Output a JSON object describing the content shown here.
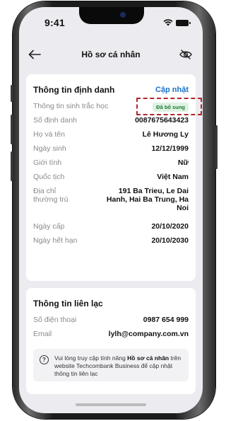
{
  "status_bar": {
    "time": "9:41"
  },
  "header": {
    "title": "Hồ sơ cá nhân"
  },
  "identity": {
    "title": "Thông tin định danh",
    "update_link": "Cập nhật",
    "biometric": {
      "label": "Thông tin sinh trắc học",
      "badge": "Đã bổ sung"
    },
    "rows": [
      {
        "label": "Số định danh",
        "value": "0087675643423"
      },
      {
        "label": "Họ và tên",
        "value": "Lê Hương Ly"
      },
      {
        "label": "Ngày sinh",
        "value": "12/12/1999"
      },
      {
        "label": "Giới tính",
        "value": "Nữ"
      },
      {
        "label": "Quốc tịch",
        "value": "Việt Nam"
      }
    ],
    "address": {
      "label_line1": "Địa chỉ",
      "label_line2": "thường trú",
      "value": "191 Ba Trieu, Le Dai Hanh, Hai Ba Trung, Ha Noi"
    },
    "rows2": [
      {
        "label": "Ngày cấp",
        "value": "20/10/2020"
      },
      {
        "label": "Ngày hết hạn",
        "value": "20/10/2030"
      }
    ]
  },
  "contact": {
    "title": "Thông tin liên lạc",
    "rows": [
      {
        "label": "Số điện thoại",
        "value": "0987 654 999"
      },
      {
        "label": "Email",
        "value": "lylh@company.com.vn"
      }
    ],
    "notice": {
      "icon": "?",
      "part1": "Vui lòng truy cập tính năng ",
      "bold": "Hồ sơ cá nhân",
      "part2": " trên website Techcombank Business để cập nhật thông tin liên lạc"
    }
  }
}
